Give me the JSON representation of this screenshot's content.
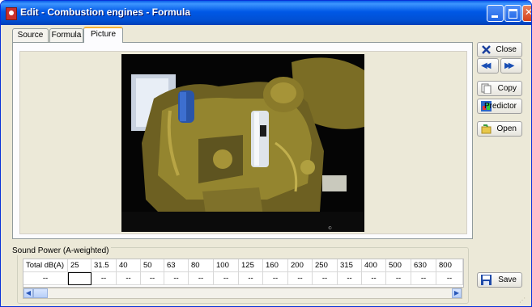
{
  "window": {
    "title": "Edit - Combustion engines - Formula"
  },
  "tabs": [
    {
      "label": "Source"
    },
    {
      "label": "Formula"
    },
    {
      "label": "Picture"
    }
  ],
  "buttons": {
    "close": "Close",
    "copy": "Copy",
    "predictor": "Predictor",
    "open": "Open",
    "save": "Save"
  },
  "sound_power": {
    "title": "Sound Power (A-weighted)",
    "headers": [
      "Total dB(A)",
      "25",
      "31.5",
      "40",
      "50",
      "63",
      "80",
      "100",
      "125",
      "160",
      "200",
      "250",
      "315",
      "400",
      "500",
      "630",
      "800"
    ],
    "values": [
      "--",
      "",
      "--",
      "--",
      "--",
      "--",
      "--",
      "--",
      "--",
      "--",
      "--",
      "--",
      "--",
      "--",
      "--",
      "--",
      "--"
    ]
  },
  "colors": {
    "titlebar": "#0058e6",
    "tab_highlight": "#f8b335",
    "engine": "#8a7a2a"
  }
}
